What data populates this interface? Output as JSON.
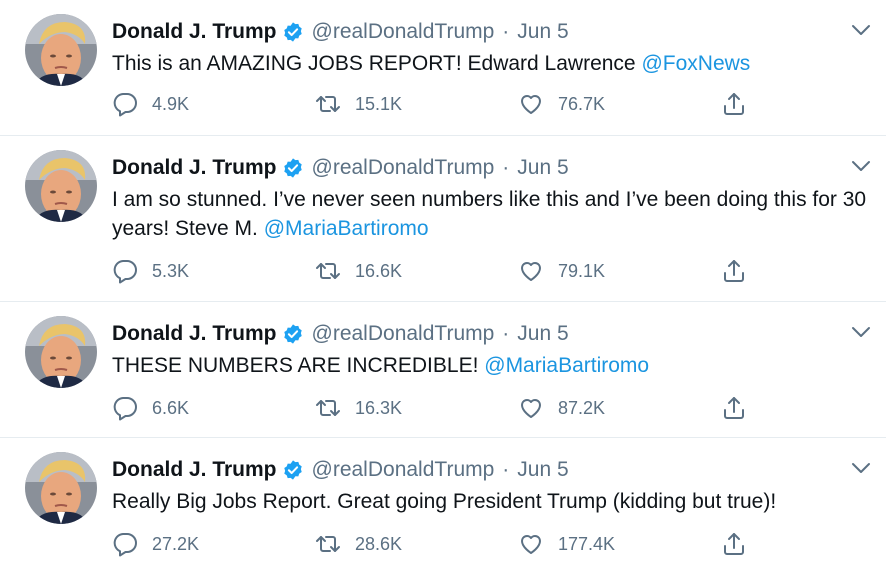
{
  "colors": {
    "accent": "#1b95e0",
    "verified": "#1da1f2",
    "secondary_text": "#5b7083",
    "divider": "#e6ecf0"
  },
  "icons": {
    "reply": "reply-icon",
    "retweet": "retweet-icon",
    "like": "heart-icon",
    "share": "share-icon",
    "verified": "verified-badge-icon",
    "more": "chevron-down-icon"
  },
  "tweets": [
    {
      "name": "Donald J. Trump",
      "handle": "@realDonaldTrump",
      "separator": "·",
      "date": "Jun 5",
      "text": "This is an AMAZING JOBS REPORT! Edward Lawrence ",
      "mention": "@FoxNews",
      "replies": "4.9K",
      "retweets": "15.1K",
      "likes": "76.7K"
    },
    {
      "name": "Donald J. Trump",
      "handle": "@realDonaldTrump",
      "separator": "·",
      "date": "Jun 5",
      "text": "I am so stunned. I’ve never seen numbers like this and I’ve been doing this for 30 years! Steve M. ",
      "mention": "@MariaBartiromo",
      "replies": "5.3K",
      "retweets": "16.6K",
      "likes": "79.1K"
    },
    {
      "name": "Donald J. Trump",
      "handle": "@realDonaldTrump",
      "separator": "·",
      "date": "Jun 5",
      "text": "THESE NUMBERS ARE INCREDIBLE! ",
      "mention": "@MariaBartiromo",
      "replies": "6.6K",
      "retweets": "16.3K",
      "likes": "87.2K"
    },
    {
      "name": "Donald J. Trump",
      "handle": "@realDonaldTrump",
      "separator": "·",
      "date": "Jun 5",
      "text": "Really Big Jobs Report. Great going President Trump (kidding but true)!",
      "mention": "",
      "replies": "27.2K",
      "retweets": "28.6K",
      "likes": "177.4K"
    }
  ]
}
